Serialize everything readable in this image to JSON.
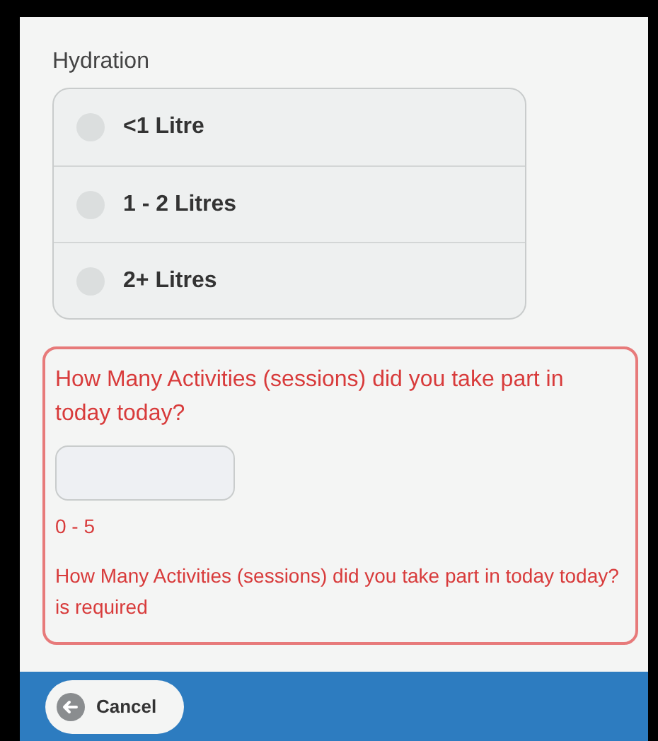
{
  "hydration": {
    "label": "Hydration",
    "options": [
      {
        "label": "<1 Litre",
        "selected": false
      },
      {
        "label": "1 - 2 Litres",
        "selected": false
      },
      {
        "label": "2+ Litres",
        "selected": false
      }
    ]
  },
  "activities": {
    "question": "How Many Activities (sessions) did you take part in today today?",
    "range": "0 - 5",
    "error": "How Many Activities (sessions) did you take part in today today? is required"
  },
  "footer": {
    "cancel": "Cancel"
  }
}
